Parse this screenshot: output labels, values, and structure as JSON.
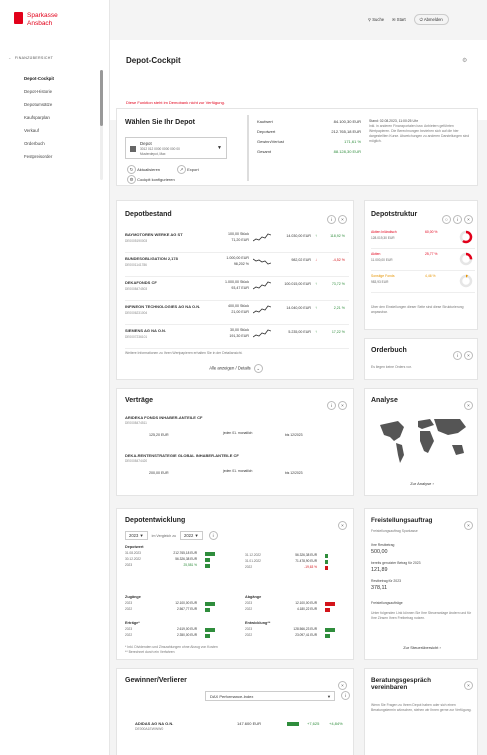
{
  "brand": {
    "line1": "Sparkasse",
    "line2": "Ansbach"
  },
  "nav": {
    "back": "FINANZÜBERSICHT",
    "items": [
      "Depot-Cockpit",
      "Depot-Historie",
      "Depotumsätze",
      "Kaufsparplan",
      "Verkauf",
      "Orderbuch",
      "Festpreisorder"
    ],
    "active": 0
  },
  "topbar": {
    "search": "Suche",
    "mail": "Start",
    "logout": "Abmelden"
  },
  "page": {
    "title": "Depot-Cockpit",
    "error": "Diese Funktion steht im Demobank nicht zur Verfügung."
  },
  "depot_select": {
    "title": "Wählen Sie Ihr Depot",
    "depot_label": "Depot",
    "depot_number": "3012 012 0000 0000 000 00",
    "depot_owner": "Musterdepot, Max",
    "option1": "Aktualisieren",
    "option2": "Export",
    "option3": "Cockpit konfigurieren"
  },
  "summary": {
    "rows": [
      {
        "label": "Kaufwert",
        "value": "84.100,30 EUR"
      },
      {
        "label": "Depotwert",
        "value": "212.765,18 EUR"
      },
      {
        "label": "Gewinn/Verlust",
        "value": "171,61 %",
        "color": "#2f8d3c"
      },
      {
        "label": "Gesamt",
        "value": "88.128,30 EUR",
        "color": "#2f8d3c"
      }
    ],
    "note": "Stand: 02.08.2023, 11:00:25 Uhr",
    "note_text": "Inkl. in anderen Finanzportalen bzw. Anbietern geführten Wertpapieren. Die Berechnungen beziehen sich auf die hier dargestellten Kurse. Abweichungen zu anderen Darstellungen sind möglich."
  },
  "depotbestand": {
    "title": "Depotbestand",
    "positions": [
      {
        "name": "BAYMOTOREN WERKE AG ST",
        "isin": "DE0005190003",
        "qty": "100,00 Stück",
        "price": "71,20 EUR",
        "value": "14.030,00 EUR",
        "change": "118,92 %",
        "trend": "up"
      },
      {
        "name": "BUNDESOBLIGATION 2,178",
        "isin": "DE0001141786",
        "qty": "1.000,00 EUR",
        "price": "98,202 %",
        "value": "982,02 EUR",
        "change": "-4,52 %",
        "trend": "down"
      },
      {
        "name": "DEKAFONDS CF",
        "isin": "DE0008474503",
        "qty": "1.000,00 Stück",
        "price": "93,47 EUR",
        "value": "100.015,00 EUR",
        "change": "73,72 %",
        "trend": "up"
      },
      {
        "name": "INFINEON TECHNOLOGIES AG NA O.N.",
        "isin": "DE0006231004",
        "qty": "400,00 Stück",
        "price": "21,00 EUR",
        "value": "14.040,00 EUR",
        "change": "2,21 %",
        "trend": "up"
      },
      {
        "name": "SIEMENS AG NA O.N.",
        "isin": "DE0007236101",
        "qty": "30,00 Stück",
        "price": "191,30 EUR",
        "value": "5.235,00 EUR",
        "change": "17,22 %",
        "trend": "up"
      }
    ],
    "footnote": "Weitere Informationen zu Ihren Wertpapieren erhalten Sie in der Detailansicht.",
    "more": "Alle anzeigen / Details"
  },
  "depotstruktur": {
    "title": "Depotstruktur",
    "items": [
      {
        "label": "Aktien Inländisch",
        "pct": "60,00 %",
        "value": "128.019,30 EUR",
        "color": "#e2001a"
      },
      {
        "label": "Aktien",
        "pct": "25,77 %",
        "value": "11.000,00 EUR",
        "color": "#e2001a"
      },
      {
        "label": "Sonstige Fonds",
        "pct": "4,46 %",
        "value": "983,93 EUR",
        "color": "#e69400"
      }
    ],
    "note": "Über den Einstellungen dieser Seite sind diese Strukturierung anpassbar."
  },
  "orderbuch": {
    "title": "Orderbuch",
    "text": "Es liegen keine Orders vor."
  },
  "analyse": {
    "title": "Analyse",
    "link": "Zur Analyse"
  },
  "vertraege": {
    "title": "Verträge",
    "items": [
      {
        "name": "ARIDEKA FONDS INHABER-ANTEILE CF",
        "isin": "DE0008474511",
        "amount": "125,20 EUR",
        "freq": "jeden 01. monatlich",
        "date": "bis 12/2023"
      },
      {
        "name": "DEKA-RENTENSTRATEGIE GLOBAL INHABER-ANTEILE CF",
        "isin": "DE0008474420",
        "amount": "200,00 EUR",
        "freq": "jeden 01. monatlich",
        "date": "bis 12/2023"
      }
    ]
  },
  "depotentwicklung": {
    "title": "Depotentwicklung",
    "year": "2023",
    "compare_label": "im Vergleich zu",
    "compare_year": "2022",
    "sections": [
      {
        "title": "Depotwert",
        "rows": [
          {
            "a": "31.08.2023",
            "b": "212.765,18 EUR"
          },
          {
            "a": "30.12.2022",
            "b": "56.326,38 EUR"
          },
          {
            "a": "2023",
            "b": "25,581 %",
            "c": "green"
          }
        ]
      },
      {
        "title": "Zugänge",
        "rows": [
          {
            "a": "2023",
            "b": "12.100,00 EUR"
          },
          {
            "a": "2022",
            "b": "2.567,77 EUR"
          }
        ]
      },
      {
        "title": "Abgänge",
        "rows": [
          {
            "a": "2023",
            "b": "12.100,00 EUR"
          },
          {
            "a": "2022",
            "b": "4.180,22 EUR"
          }
        ]
      },
      {
        "title": "Erträge*",
        "rows": [
          {
            "a": "2023",
            "b": "2.619,00 EUR"
          },
          {
            "a": "2022",
            "b": "2.350,00 EUR"
          }
        ]
      },
      {
        "title": "Entwicklung**",
        "rows": [
          {
            "a": "2023",
            "b": "128.566,23 EUR"
          },
          {
            "a": "2022",
            "b": "23.097,41 EUR"
          }
        ]
      }
    ],
    "right_rows": [
      {
        "a": "31.12.2022",
        "b": "56.326,38 EUR"
      },
      {
        "a": "31.01.2022",
        "b": "71.478,90 EUR"
      },
      {
        "a": "2022",
        "b": "-19,63 %",
        "c": "red"
      }
    ],
    "foot1": "* Inkl. Dividenden und Zinszahlungen ohne Abzug von Kosten",
    "foot2": "** Berechnet durch ein Verfahren"
  },
  "freistellung": {
    "title": "Freistellungsauftrag",
    "subtitle": "Freistellungsauftrag Sparkasse",
    "l1": "Ihre Restbetrag",
    "v1": "500,00",
    "l2": "bereits genutzter Betrag für 2023",
    "v2": "121,89",
    "l3": "Restbetrag für 2023",
    "v3": "378,11",
    "note": "Freistellungsaufträge",
    "note_text": "Unter folgenden Link können Sie Ihre Steueranlage ändern und für Ihre Zinsen Ihren Freibetrag nutzen.",
    "link": "Zur Steuerübersicht"
  },
  "gewinner": {
    "title": "Gewinner/Verlierer",
    "select": "DAX Performance-Index",
    "item_name": "ADIDAS AG NA O.N.",
    "item_isin": "DE000A1EWWW0",
    "item_value": "147.600 EUR",
    "item_change": "+7,625",
    "item_pct": "+4,84%"
  },
  "beratung": {
    "title": "Beratungsgespräch vereinbaren",
    "text": "Wenn Sie Fragen zu Ihrem Depot haben oder sich einen Beratungstermin wünschen, stehen wir Ihnen gerne zur Verfügung."
  }
}
